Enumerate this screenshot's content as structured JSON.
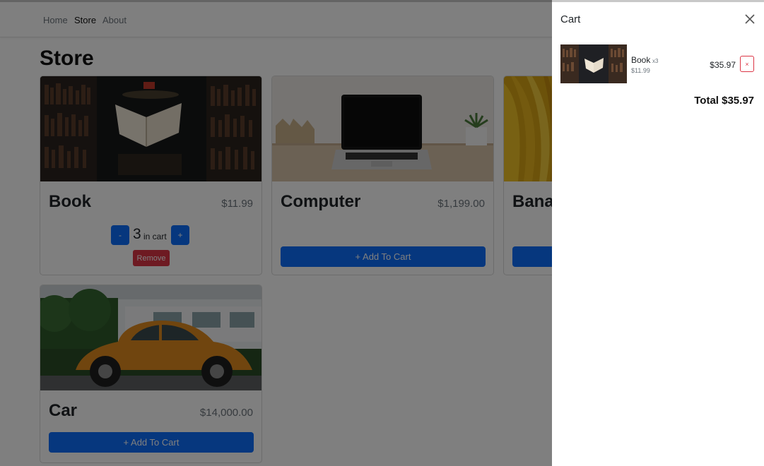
{
  "nav": {
    "links": [
      {
        "label": "Home"
      },
      {
        "label": "Store"
      },
      {
        "label": "About"
      }
    ],
    "active": "Store"
  },
  "page": {
    "title": "Store"
  },
  "products": [
    {
      "name": "Book",
      "price": "$11.99",
      "image": "book-library-image",
      "in_cart": true,
      "quantity": "3",
      "in_cart_label": "in cart",
      "minus_label": "-",
      "plus_label": "+",
      "remove_label": "Remove"
    },
    {
      "name": "Computer",
      "price": "$1,199.00",
      "image": "laptop-image",
      "in_cart": false,
      "add_label": "+ Add To Cart"
    },
    {
      "name": "Banana",
      "price": "",
      "image": "bananas-image",
      "in_cart": false,
      "add_label": "+ Add To Cart"
    },
    {
      "name": "Car",
      "price": "$14,000.00",
      "image": "orange-beetle-car-image",
      "in_cart": false,
      "add_label": "+ Add To Cart"
    }
  ],
  "cart": {
    "title": "Cart",
    "close_icon": "close-icon",
    "items": [
      {
        "name": "Book",
        "quantity": "x3",
        "unit_price": "$11.99",
        "total": "$35.97",
        "remove_label": "×"
      }
    ],
    "total": "Total $35.97"
  },
  "colors": {
    "primary": "#0d6efd",
    "danger": "#dc3545",
    "backdrop": "rgba(0,0,0,0.5)"
  }
}
